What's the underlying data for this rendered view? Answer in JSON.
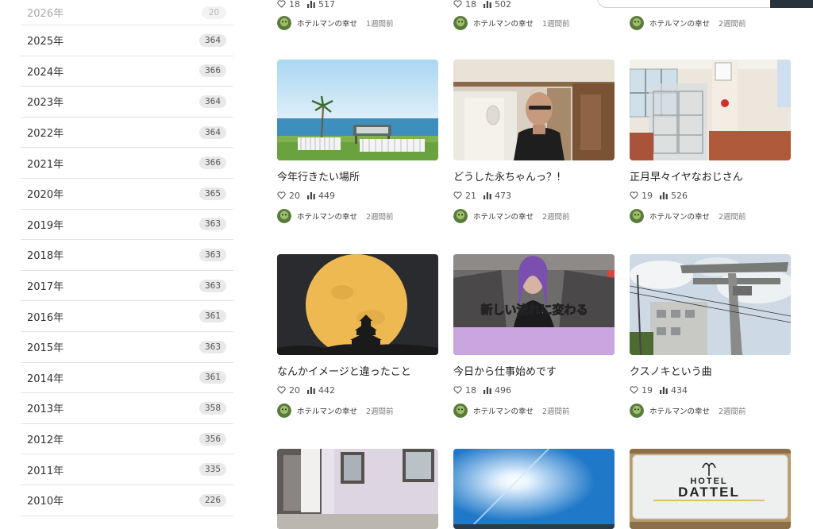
{
  "sidebar": {
    "years": [
      {
        "year": "2026年",
        "count": "20"
      },
      {
        "year": "2025年",
        "count": "364"
      },
      {
        "year": "2024年",
        "count": "366"
      },
      {
        "year": "2023年",
        "count": "364"
      },
      {
        "year": "2022年",
        "count": "364"
      },
      {
        "year": "2021年",
        "count": "366"
      },
      {
        "year": "2020年",
        "count": "365"
      },
      {
        "year": "2019年",
        "count": "363"
      },
      {
        "year": "2018年",
        "count": "363"
      },
      {
        "year": "2017年",
        "count": "363"
      },
      {
        "year": "2016年",
        "count": "361"
      },
      {
        "year": "2015年",
        "count": "363"
      },
      {
        "year": "2014年",
        "count": "361"
      },
      {
        "year": "2013年",
        "count": "358"
      },
      {
        "year": "2012年",
        "count": "356"
      },
      {
        "year": "2011年",
        "count": "335"
      },
      {
        "year": "2010年",
        "count": "226"
      }
    ]
  },
  "partial_row": [
    {
      "likes": "18",
      "views": "517",
      "author": "ホテルマンの幸せ",
      "time": "1週間前"
    },
    {
      "likes": "18",
      "views": "502",
      "author": "ホテルマンの幸せ",
      "time": "1週間前"
    },
    {
      "author": "ホテルマンの幸せ",
      "time": "2週間前"
    }
  ],
  "articles": [
    {
      "title": "今年行きたい場所",
      "likes": "20",
      "views": "449",
      "author": "ホテルマンの幸せ",
      "time": "2週間前"
    },
    {
      "title": "どうした永ちゃんっ？!",
      "likes": "21",
      "views": "473",
      "author": "ホテルマンの幸せ",
      "time": "2週間前"
    },
    {
      "title": "正月早々イヤなおじさん",
      "likes": "19",
      "views": "526",
      "author": "ホテルマンの幸せ",
      "time": "2週間前"
    },
    {
      "title": "なんかイメージと違ったこと",
      "likes": "20",
      "views": "442",
      "author": "ホテルマンの幸せ",
      "time": "2週間前"
    },
    {
      "title": "今日から仕事始めです",
      "likes": "18",
      "views": "496",
      "author": "ホテルマンの幸せ",
      "time": "2週間前"
    },
    {
      "title": "クスノキという曲",
      "likes": "19",
      "views": "434",
      "author": "ホテルマンの幸せ",
      "time": "2週間前"
    }
  ],
  "thumb_texts": {
    "overlay_caption": "新しい流れに変わる",
    "hotel_sign_top": "HOTEL",
    "hotel_sign_name": "DATTEL"
  },
  "icons": {
    "like": "heart-outline-icon",
    "views": "bar-chart-icon",
    "search": "search-button"
  },
  "colors": {
    "accent": "#27333d",
    "badge_bg": "#e9e9e9",
    "divider": "#e2e2e2"
  }
}
